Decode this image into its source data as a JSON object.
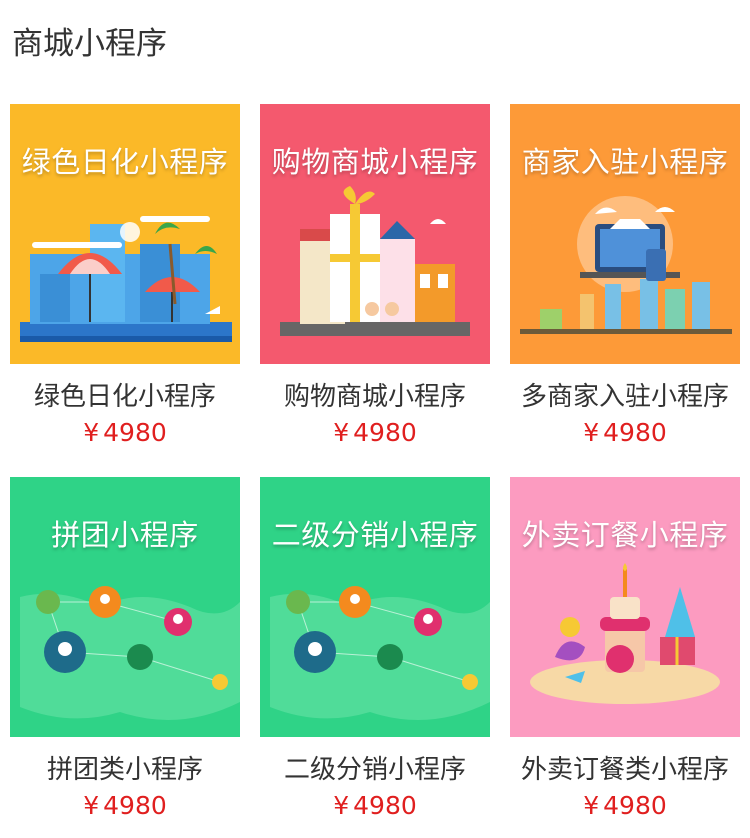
{
  "page": {
    "title": "商城小程序"
  },
  "products": [
    {
      "banner": "绿色日化小程序",
      "name": "绿色日化小程序",
      "currency": "¥",
      "price": "4980",
      "color": "#fbb928"
    },
    {
      "banner": "购物商城小程序",
      "name": "购物商城小程序",
      "currency": "¥",
      "price": "4980",
      "color": "#f4596e"
    },
    {
      "banner": "商家入驻小程序",
      "name": "多商家入驻小程序",
      "currency": "¥",
      "price": "4980",
      "color": "#fd9a38"
    },
    {
      "banner": "拼团小程序",
      "name": "拼团类小程序",
      "currency": "¥",
      "price": "4980",
      "color": "#2fd387"
    },
    {
      "banner": "二级分销小程序",
      "name": "二级分销小程序",
      "currency": "¥",
      "price": "4980",
      "color": "#2fd387"
    },
    {
      "banner": "外卖订餐小程序",
      "name": "外卖订餐类小程序",
      "currency": "¥",
      "price": "4980",
      "color": "#fc9bc0"
    }
  ]
}
